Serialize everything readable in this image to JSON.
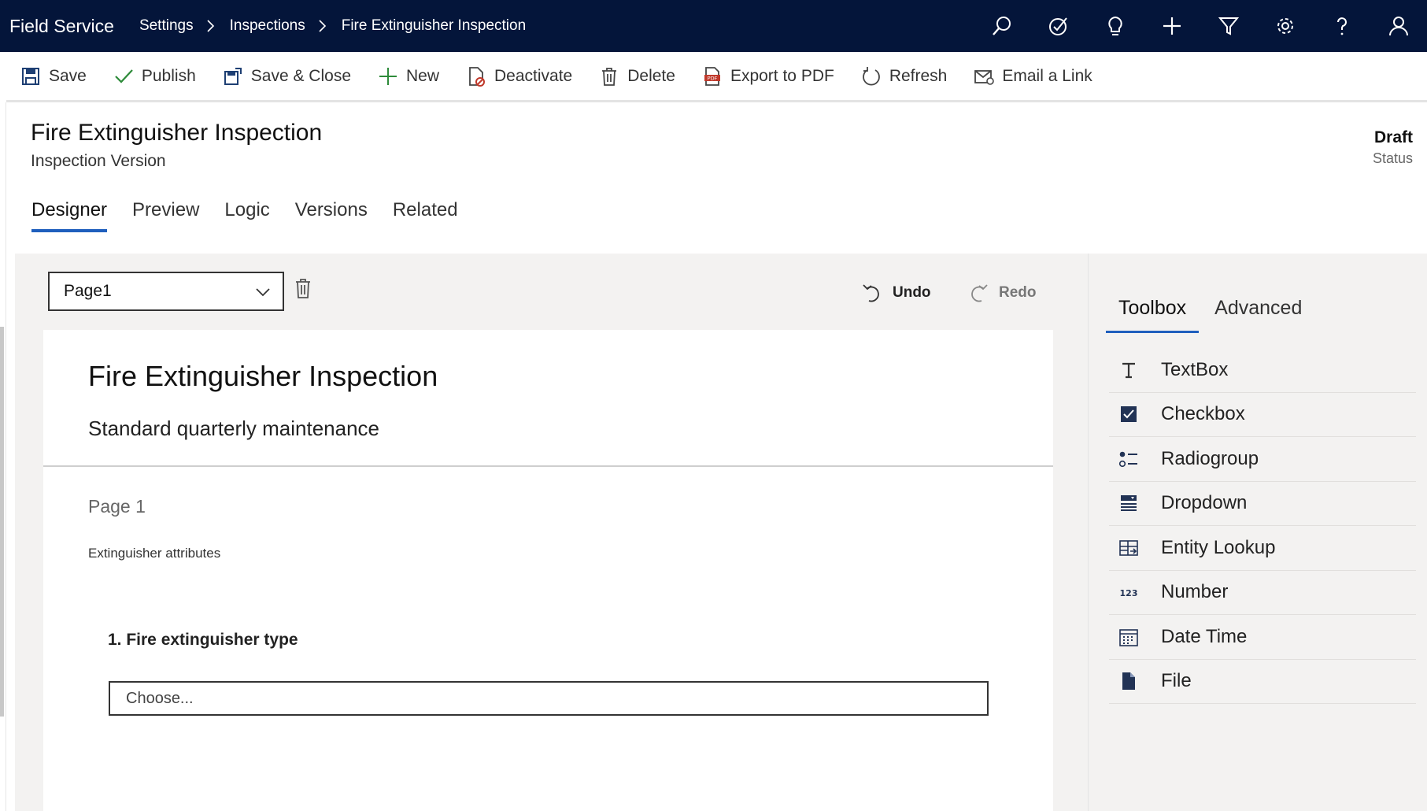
{
  "topnav": {
    "app_name": "Field Service",
    "breadcrumbs": [
      "Settings",
      "Inspections",
      "Fire Extinguisher Inspection"
    ],
    "icons": [
      "search-icon",
      "task-icon",
      "lightbulb-icon",
      "plus-icon",
      "filter-icon",
      "gear-icon",
      "help-icon",
      "person-icon"
    ]
  },
  "commands": [
    {
      "label": "Save",
      "icon": "save-icon"
    },
    {
      "label": "Publish",
      "icon": "checkmark-icon"
    },
    {
      "label": "Save & Close",
      "icon": "save-close-icon"
    },
    {
      "label": "New",
      "icon": "plus-icon"
    },
    {
      "label": "Deactivate",
      "icon": "deactivate-icon"
    },
    {
      "label": "Delete",
      "icon": "trash-icon"
    },
    {
      "label": "Export to PDF",
      "icon": "pdf-icon"
    },
    {
      "label": "Refresh",
      "icon": "refresh-icon"
    },
    {
      "label": "Email a Link",
      "icon": "email-icon"
    }
  ],
  "header": {
    "title": "Fire Extinguisher Inspection",
    "subtitle": "Inspection Version",
    "status_value": "Draft",
    "status_label": "Status"
  },
  "tabs": [
    {
      "label": "Designer",
      "active": true
    },
    {
      "label": "Preview",
      "active": false
    },
    {
      "label": "Logic",
      "active": false
    },
    {
      "label": "Versions",
      "active": false
    },
    {
      "label": "Related",
      "active": false
    }
  ],
  "designer": {
    "page_select_value": "Page1",
    "undo_label": "Undo",
    "redo_label": "Redo",
    "form_title": "Fire Extinguisher Inspection",
    "form_description": "Standard quarterly maintenance",
    "page_label": "Page 1",
    "page_description": "Extinguisher attributes",
    "question_label": "1. Fire extinguisher type",
    "question_placeholder": "Choose..."
  },
  "panel": {
    "tabs": [
      {
        "label": "Toolbox",
        "active": true
      },
      {
        "label": "Advanced",
        "active": false
      }
    ],
    "tools": [
      {
        "label": "TextBox",
        "icon": "textbox-icon"
      },
      {
        "label": "Checkbox",
        "icon": "checkbox-icon"
      },
      {
        "label": "Radiogroup",
        "icon": "radiogroup-icon"
      },
      {
        "label": "Dropdown",
        "icon": "dropdown-icon"
      },
      {
        "label": "Entity Lookup",
        "icon": "entity-lookup-icon"
      },
      {
        "label": "Number",
        "icon": "number-icon"
      },
      {
        "label": "Date Time",
        "icon": "calendar-icon"
      },
      {
        "label": "File",
        "icon": "file-icon"
      }
    ]
  },
  "colors": {
    "nav_background": "#04153a",
    "accent": "#1f5fbd",
    "canvas_background": "#f3f2f1"
  }
}
